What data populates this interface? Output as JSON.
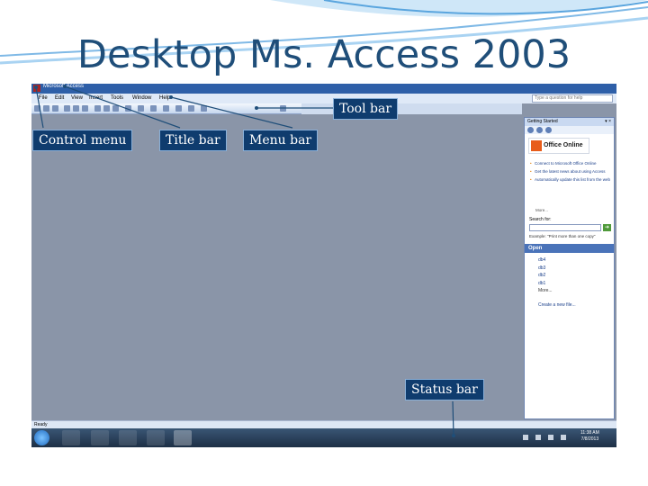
{
  "slide": {
    "title": "Desktop Ms. Access 2003"
  },
  "window": {
    "title": "Microsoft Access",
    "menu": [
      "File",
      "Edit",
      "View",
      "Insert",
      "Tools",
      "Window",
      "Help"
    ],
    "help_placeholder": "Type a question for help",
    "status": "Ready"
  },
  "task_pane": {
    "header": "Getting Started",
    "logo_text": "Office Online",
    "links": [
      "Connect to Microsoft Office Online",
      "Get the latest news about using Access",
      "Automatically update this list from the web"
    ],
    "more": "More...",
    "search_label": "Search for:",
    "search_example": "Example: \"Print more than one copy\"",
    "open_header": "Open",
    "open_files": [
      "db4",
      "db3",
      "db2",
      "db1"
    ],
    "open_more": "More...",
    "create_new": "Create a new file..."
  },
  "taskbar": {
    "time": "11:38 AM",
    "date": "7/8/2013"
  },
  "callouts": {
    "tool_bar": "Tool bar",
    "control_menu": "Control menu",
    "title_bar": "Title bar",
    "menu_bar": "Menu bar",
    "status_bar": "Status  bar"
  },
  "colors": {
    "title": "#1f4e79",
    "callout_bg": "#0f3c6e",
    "workspace": "#8a95a8"
  }
}
